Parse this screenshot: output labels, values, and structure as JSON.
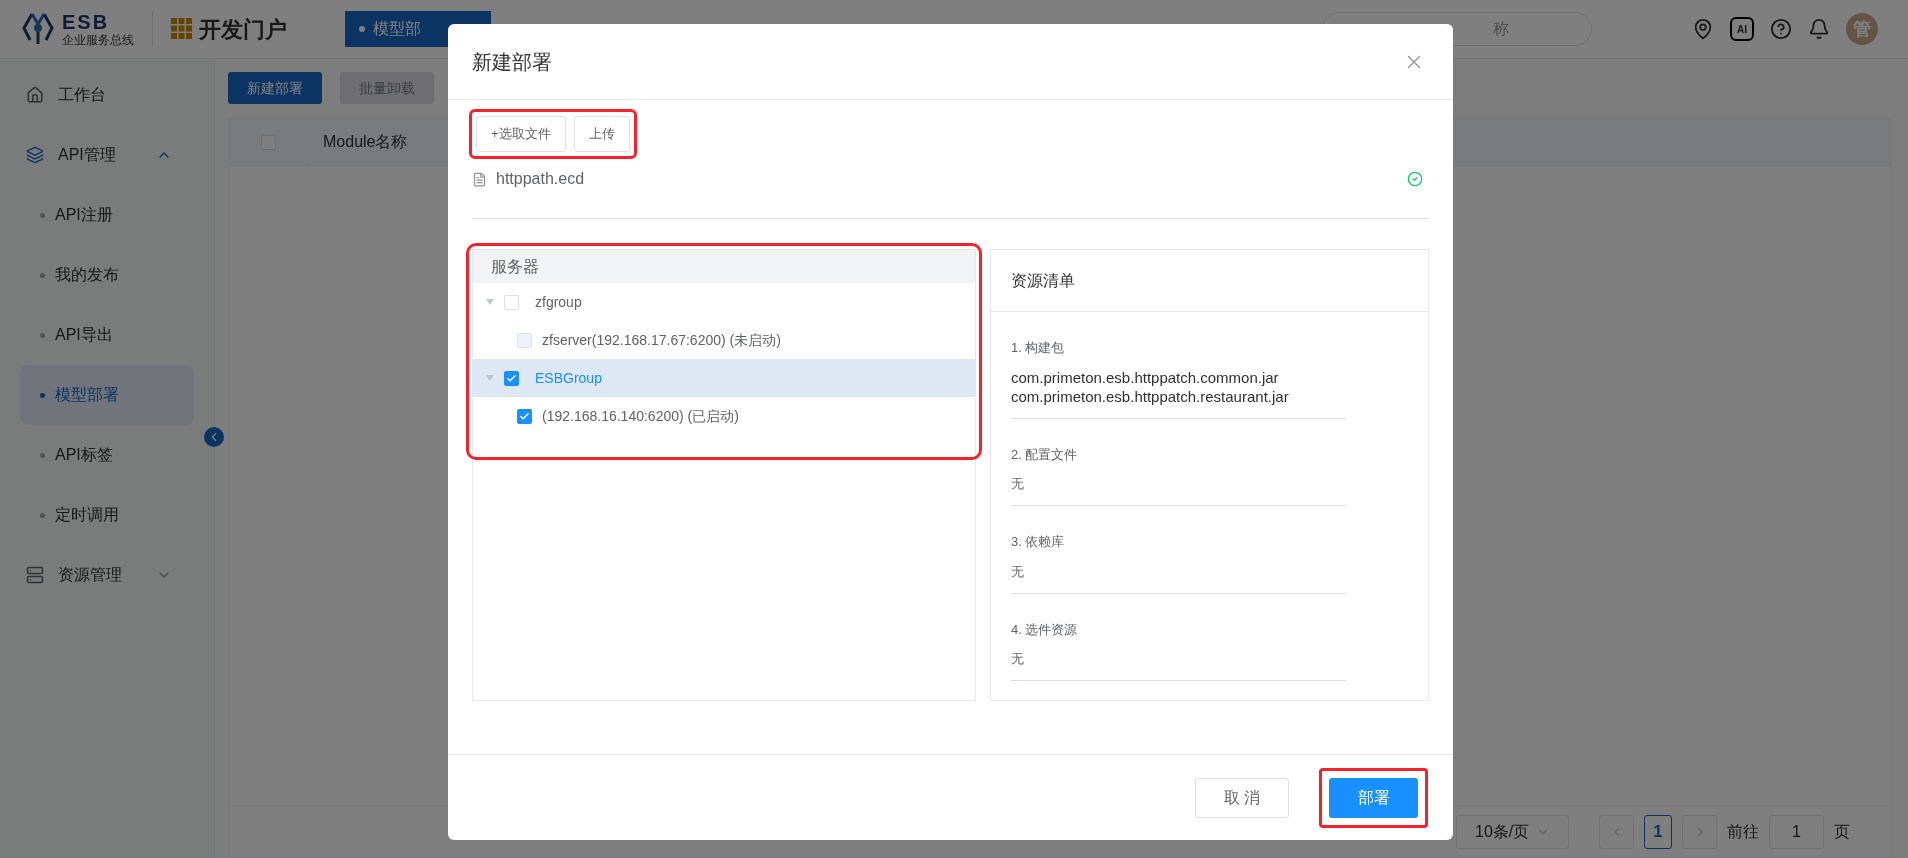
{
  "header": {
    "logo_title": "ESB",
    "logo_subtitle": "企业服务总线",
    "portal_title": "开发门户",
    "tab": "模型部",
    "search": {
      "placeholder": "称"
    },
    "ai_badge": "AI",
    "avatar": "管"
  },
  "sidebar": {
    "items": [
      {
        "kind": "item",
        "label": "工作台"
      },
      {
        "kind": "group",
        "label": "API管理",
        "expanded": true,
        "children": [
          {
            "label": "API注册",
            "selected": false
          },
          {
            "label": "我的发布",
            "selected": false
          },
          {
            "label": "API导出",
            "selected": false
          },
          {
            "label": "模型部署",
            "selected": true
          },
          {
            "label": "API标签",
            "selected": false
          },
          {
            "label": "定时调用",
            "selected": false
          }
        ]
      },
      {
        "kind": "group",
        "label": "资源管理",
        "expanded": false
      }
    ]
  },
  "toolbar": {
    "buttons": [
      {
        "label": "新建部署",
        "disabled": false
      },
      {
        "label": "批量卸载",
        "disabled": true
      }
    ]
  },
  "table": {
    "select_all_checked": false,
    "columns": [
      "Module名称"
    ]
  },
  "pagination": {
    "page_size": "10条/页",
    "pages": [
      {
        "label": "1",
        "selected": true
      }
    ],
    "goto_label": "前往",
    "goto_value": "1",
    "page_suffix": "页"
  },
  "dialog": {
    "title": "新建部署",
    "upload": {
      "highlighted": true,
      "buttons": [
        "+选取文件",
        "上传"
      ]
    },
    "file": {
      "name": "httppath.ecd",
      "uploaded": true
    },
    "server_tree": {
      "highlighted": true,
      "header": "服务器",
      "nodes": [
        {
          "label": "zfgroup",
          "checked": false,
          "selected": false,
          "expanded": true,
          "children": [
            {
              "label": "zfserver(192.168.17.67:6200) (未启动)",
              "checked": false,
              "disabled": true
            }
          ]
        },
        {
          "label": "ESBGroup",
          "checked": true,
          "selected": true,
          "expanded": true,
          "children": [
            {
              "label": "(192.168.16.140:6200) (已启动)",
              "checked": true,
              "disabled": false
            }
          ]
        }
      ]
    },
    "resources": {
      "title": "资源清单",
      "sections": [
        {
          "title": "1. 构建包",
          "items": [
            "com.primeton.esb.httppatch.common.jar",
            "com.primeton.esb.httppatch.restaurant.jar"
          ]
        },
        {
          "title": "2. 配置文件",
          "items": [
            "无"
          ]
        },
        {
          "title": "3. 依赖库",
          "items": [
            "无"
          ]
        },
        {
          "title": "4. 选件资源",
          "items": [
            "无"
          ]
        }
      ]
    },
    "footer_buttons": [
      {
        "label": "取 消",
        "kind": "default",
        "highlighted": false
      },
      {
        "label": "部署",
        "kind": "primary",
        "highlighted": true
      }
    ]
  }
}
